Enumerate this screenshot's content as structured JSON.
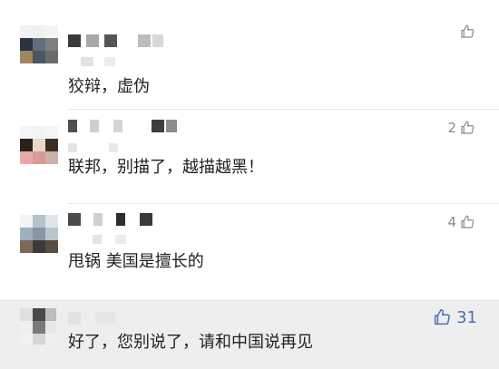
{
  "comments": [
    {
      "text": "狡辩，虚伪",
      "likes": ""
    },
    {
      "text": "联邦，别描了，越描越黑！",
      "likes": "2"
    },
    {
      "text": "甩锅 美国是擅长的",
      "likes": "4"
    },
    {
      "text": "好了，您别说了，请和中国说再见",
      "likes": "31",
      "liked": true
    }
  ],
  "icons": {
    "like": "thumbs-up-icon",
    "avatar": "blurred-avatar",
    "name": "blurred-username"
  },
  "colors": {
    "like_default": "#8a8a8a",
    "like_active": "#4a6fb5",
    "highlight_bg": "#eeeeee"
  }
}
